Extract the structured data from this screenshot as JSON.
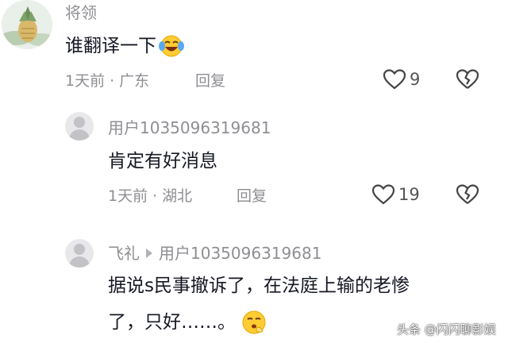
{
  "comments": [
    {
      "username": "将领",
      "text": "谁翻译一下",
      "time": "1天前",
      "location": "广东",
      "reply_label": "回复",
      "likes": "9",
      "emoji": "laughing-tears"
    },
    {
      "username": "用户1035096319681",
      "text": "肯定有好消息",
      "time": "1天前",
      "location": "湖北",
      "reply_label": "回复",
      "likes": "19"
    },
    {
      "username": "飞礼",
      "reply_to": "用户1035096319681",
      "text_line1": "据说s民事撤诉了，在法庭上输的老惨",
      "text_line2": "了，只好……。",
      "emoji": "shushing-face"
    }
  ],
  "watermark": "头条 @闪闪聊影娱",
  "separator": "·"
}
